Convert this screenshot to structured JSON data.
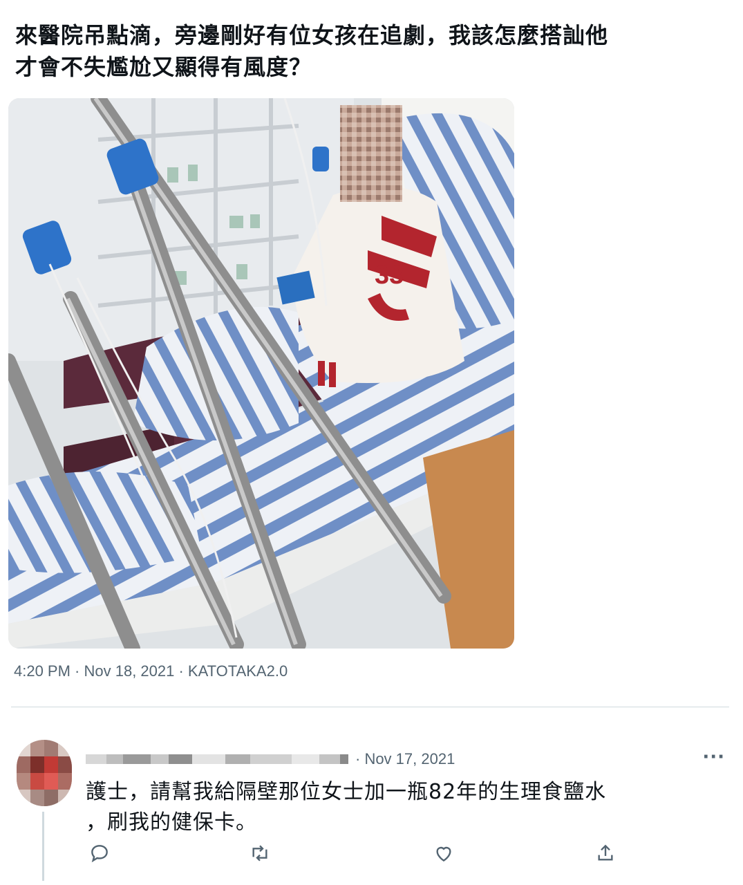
{
  "tweet": {
    "text_lines": [
      "來醫院吊點滴，旁邊剛好有位女孩在追劇，我該怎麼搭訕他",
      "才會不失尷尬又顯得有風度？"
    ],
    "meta": "4:20 PM · Nov 18, 2021 · KATOTAKA2.0"
  },
  "reply": {
    "date": "· Nov 17, 2021",
    "more": "···",
    "text_lines": [
      "護士，請幫我給隔壁那位女士加一瓶82年的生理食鹽水",
      "，刷我的健保卡。"
    ],
    "actions": [
      "reply-icon",
      "retweet-icon",
      "like-icon",
      "share-icon"
    ]
  },
  "colors": {
    "text": "#0f1419",
    "secondary": "#536471",
    "divider": "#cfd9de",
    "stripe_blue": "#6f8fc6",
    "jacket_red": "#b3252e"
  }
}
